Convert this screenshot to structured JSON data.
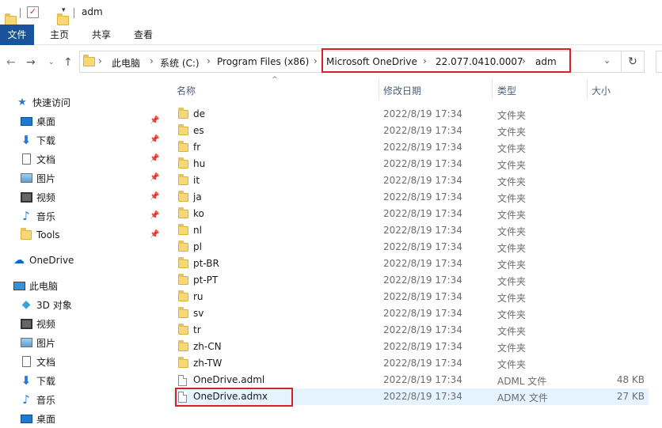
{
  "window": {
    "title": "adm"
  },
  "ribbon": {
    "tabs": [
      "文件",
      "主页",
      "共享",
      "查看"
    ]
  },
  "address": {
    "segments": [
      "此电脑",
      "系统 (C:)",
      "Program Files (x86)",
      "Microsoft OneDrive",
      "22.077.0410.0007",
      "adm"
    ]
  },
  "sidebar": {
    "quick_access": "快速访问",
    "quick_items": [
      "桌面",
      "下载",
      "文档",
      "图片",
      "视频",
      "音乐",
      "Tools"
    ],
    "onedrive": "OneDrive",
    "this_pc": "此电脑",
    "pc_items": [
      "3D 对象",
      "视频",
      "图片",
      "文档",
      "下载",
      "音乐",
      "桌面"
    ]
  },
  "columns": {
    "name": "名称",
    "date": "修改日期",
    "type": "类型",
    "size": "大小"
  },
  "files": [
    {
      "name": "de",
      "date": "2022/8/19 17:34",
      "type": "文件夹",
      "size": "",
      "kind": "folder"
    },
    {
      "name": "es",
      "date": "2022/8/19 17:34",
      "type": "文件夹",
      "size": "",
      "kind": "folder"
    },
    {
      "name": "fr",
      "date": "2022/8/19 17:34",
      "type": "文件夹",
      "size": "",
      "kind": "folder"
    },
    {
      "name": "hu",
      "date": "2022/8/19 17:34",
      "type": "文件夹",
      "size": "",
      "kind": "folder"
    },
    {
      "name": "it",
      "date": "2022/8/19 17:34",
      "type": "文件夹",
      "size": "",
      "kind": "folder"
    },
    {
      "name": "ja",
      "date": "2022/8/19 17:34",
      "type": "文件夹",
      "size": "",
      "kind": "folder"
    },
    {
      "name": "ko",
      "date": "2022/8/19 17:34",
      "type": "文件夹",
      "size": "",
      "kind": "folder"
    },
    {
      "name": "nl",
      "date": "2022/8/19 17:34",
      "type": "文件夹",
      "size": "",
      "kind": "folder"
    },
    {
      "name": "pl",
      "date": "2022/8/19 17:34",
      "type": "文件夹",
      "size": "",
      "kind": "folder"
    },
    {
      "name": "pt-BR",
      "date": "2022/8/19 17:34",
      "type": "文件夹",
      "size": "",
      "kind": "folder"
    },
    {
      "name": "pt-PT",
      "date": "2022/8/19 17:34",
      "type": "文件夹",
      "size": "",
      "kind": "folder"
    },
    {
      "name": "ru",
      "date": "2022/8/19 17:34",
      "type": "文件夹",
      "size": "",
      "kind": "folder"
    },
    {
      "name": "sv",
      "date": "2022/8/19 17:34",
      "type": "文件夹",
      "size": "",
      "kind": "folder"
    },
    {
      "name": "tr",
      "date": "2022/8/19 17:34",
      "type": "文件夹",
      "size": "",
      "kind": "folder"
    },
    {
      "name": "zh-CN",
      "date": "2022/8/19 17:34",
      "type": "文件夹",
      "size": "",
      "kind": "folder"
    },
    {
      "name": "zh-TW",
      "date": "2022/8/19 17:34",
      "type": "文件夹",
      "size": "",
      "kind": "folder"
    },
    {
      "name": "OneDrive.adml",
      "date": "2022/8/19 17:34",
      "type": "ADML 文件",
      "size": "48 KB",
      "kind": "file"
    },
    {
      "name": "OneDrive.admx",
      "date": "2022/8/19 17:34",
      "type": "ADMX 文件",
      "size": "27 KB",
      "kind": "file",
      "selected": true
    }
  ],
  "colors": {
    "accent": "#19539c",
    "highlight": "#d6202a",
    "folder": "#f8d775",
    "selected_row": "#e5f3ff"
  }
}
